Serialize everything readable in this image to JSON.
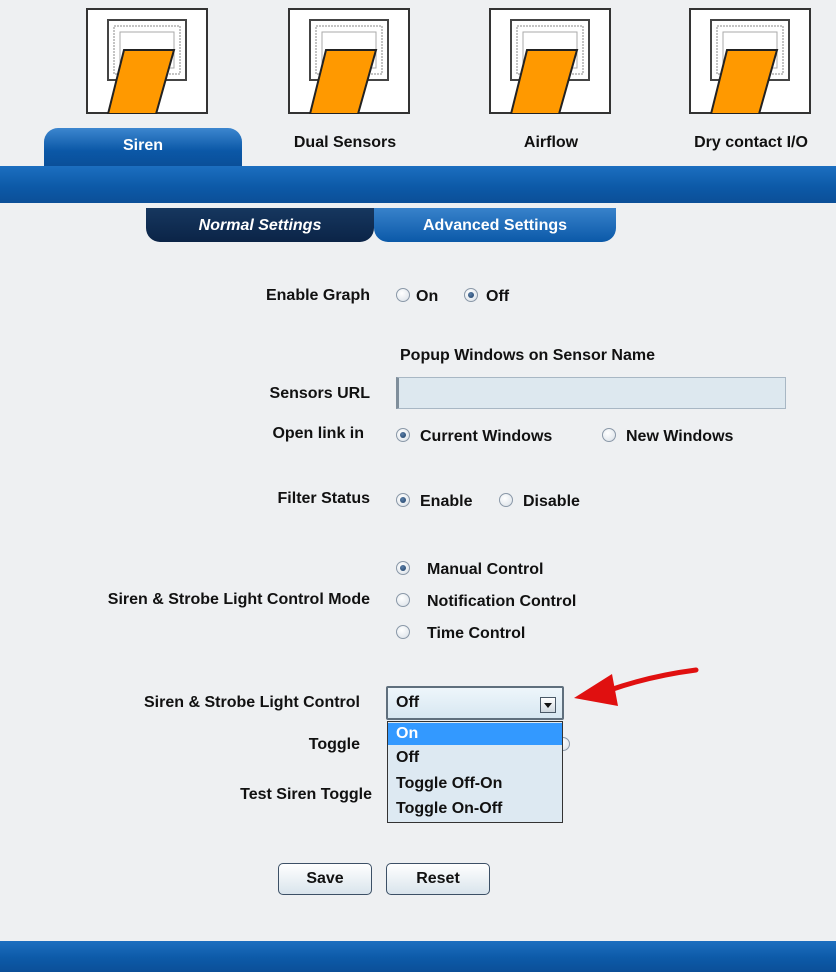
{
  "device_tabs": [
    {
      "label": "Siren",
      "active": true
    },
    {
      "label": "Dual Sensors",
      "active": false
    },
    {
      "label": "Airflow",
      "active": false
    },
    {
      "label": "Dry contact I/O",
      "active": false
    }
  ],
  "settings_tabs": {
    "normal": "Normal Settings",
    "advanced": "Advanced Settings"
  },
  "enable_graph": {
    "label": "Enable Graph",
    "on": "On",
    "off": "Off",
    "selected": "Off"
  },
  "popup_heading": "Popup Windows on Sensor Name",
  "sensors_url": {
    "label": "Sensors URL",
    "value": "",
    "placeholder": ""
  },
  "open_link": {
    "label": "Open link in",
    "current": "Current Windows",
    "new": "New Windows",
    "selected": "Current Windows"
  },
  "filter_status": {
    "label": "Filter Status",
    "enable": "Enable",
    "disable": "Disable",
    "selected": "Enable"
  },
  "control_mode": {
    "label": "Siren & Strobe Light Control Mode",
    "options": [
      "Manual Control",
      "Notification Control",
      "Time Control"
    ],
    "selected": "Manual Control"
  },
  "light_control": {
    "label": "Siren & Strobe Light Control",
    "value": "Off",
    "options": [
      "On",
      "Off",
      "Toggle Off-On",
      "Toggle On-Off"
    ],
    "highlighted": "On"
  },
  "toggle": {
    "label": "Toggle"
  },
  "test_siren": {
    "label": "Test Siren Toggle"
  },
  "buttons": {
    "save": "Save",
    "reset": "Reset"
  },
  "colors": {
    "band_blue": "#0d5aa8",
    "navy_tab": "#0b2447",
    "accent_orange": "#ff9900",
    "arrow_red": "#e01010"
  },
  "icons": [
    "sensor-port-icon",
    "radio-icon",
    "dropdown-arrow-icon",
    "red-arrow-icon"
  ]
}
